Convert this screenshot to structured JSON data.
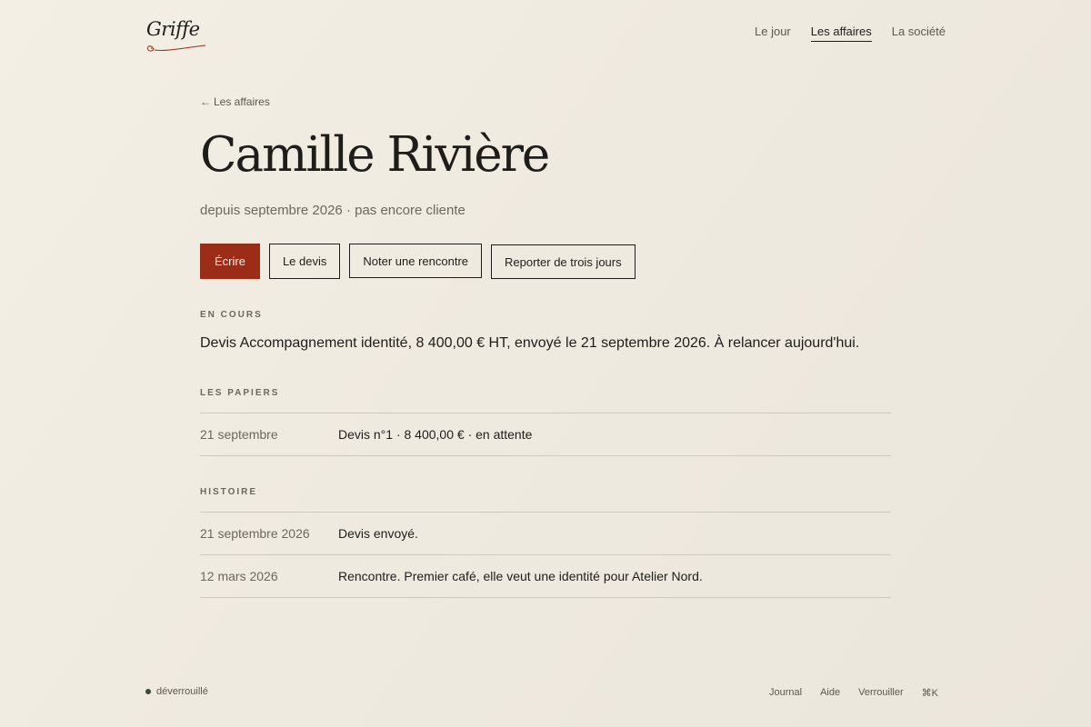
{
  "header": {
    "logo": "Griffe",
    "nav": [
      {
        "label": "Le jour",
        "active": false
      },
      {
        "label": "Les affaires",
        "active": true
      },
      {
        "label": "La société",
        "active": false
      }
    ]
  },
  "main": {
    "back_link": "Les affaires",
    "title": "Camille Rivière",
    "subtitle": "depuis septembre 2026 · pas encore cliente",
    "actions": [
      "Écrire",
      "Le devis",
      "Noter une rencontre",
      "Reporter de trois jours"
    ],
    "current": {
      "label": "EN COURS",
      "text": "Devis Accompagnement identité, 8 400,00 € HT, envoyé le 21 septembre 2026. À relancer aujourd'hui."
    },
    "papers": {
      "label": "LES PAPIERS",
      "rows": [
        {
          "date": "21 septembre",
          "desc": "Devis n°1 · 8 400,00 € · en attente"
        }
      ]
    },
    "history": {
      "label": "HISTOIRE",
      "rows": [
        {
          "date": "21 septembre 2026",
          "desc": "Devis envoyé."
        },
        {
          "date": "12 mars 2026",
          "desc": "Rencontre. Premier café, elle veut une identité pour Atelier Nord."
        }
      ]
    }
  },
  "footer": {
    "status": "déverrouillé",
    "links": [
      "Journal",
      "Aide",
      "Verrouiller",
      "⌘K"
    ]
  },
  "colors": {
    "accent": "#9b2c17",
    "background": "#efeae0",
    "text": "#1f1d1a",
    "muted": "#6d685f",
    "rule": "#cfc9bd",
    "status_dot": "#3d4a35"
  }
}
